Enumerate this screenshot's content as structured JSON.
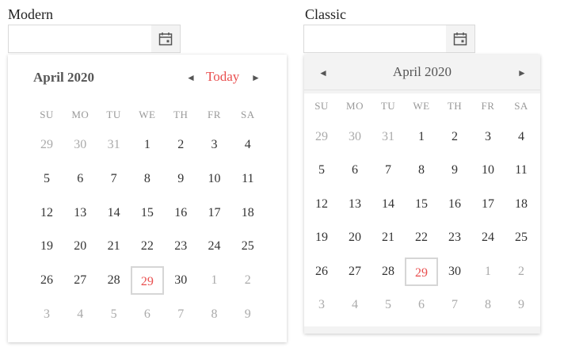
{
  "modern": {
    "label": "Modern",
    "input_value": "",
    "calendar": {
      "title": "April 2020",
      "prev_icon": "◄",
      "next_icon": "►",
      "today_label": "Today",
      "weekdays": [
        "SU",
        "MO",
        "TU",
        "WE",
        "TH",
        "FR",
        "SA"
      ],
      "weeks": [
        [
          "29",
          "30",
          "31",
          "1",
          "2",
          "3",
          "4"
        ],
        [
          "5",
          "6",
          "7",
          "8",
          "9",
          "10",
          "11"
        ],
        [
          "12",
          "13",
          "14",
          "15",
          "16",
          "17",
          "18"
        ],
        [
          "19",
          "20",
          "21",
          "22",
          "23",
          "24",
          "25"
        ],
        [
          "26",
          "27",
          "28",
          "29",
          "30",
          "1",
          "2"
        ],
        [
          "3",
          "4",
          "5",
          "6",
          "7",
          "8",
          "9"
        ]
      ],
      "selected_day": "29"
    }
  },
  "classic": {
    "label": "Classic",
    "input_value": "",
    "calendar": {
      "title": "April 2020",
      "prev_icon": "◄",
      "next_icon": "►",
      "weekdays": [
        "SU",
        "MO",
        "TU",
        "WE",
        "TH",
        "FR",
        "SA"
      ],
      "weeks": [
        [
          "29",
          "30",
          "31",
          "1",
          "2",
          "3",
          "4"
        ],
        [
          "5",
          "6",
          "7",
          "8",
          "9",
          "10",
          "11"
        ],
        [
          "12",
          "13",
          "14",
          "15",
          "16",
          "17",
          "18"
        ],
        [
          "19",
          "20",
          "21",
          "22",
          "23",
          "24",
          "25"
        ],
        [
          "26",
          "27",
          "28",
          "29",
          "30",
          "1",
          "2"
        ],
        [
          "3",
          "4",
          "5",
          "6",
          "7",
          "8",
          "9"
        ]
      ],
      "selected_day": "29"
    }
  },
  "colors": {
    "accent": "#e94e4e",
    "muted": "#aaaaaa",
    "header_bg": "#f3f3f3"
  }
}
